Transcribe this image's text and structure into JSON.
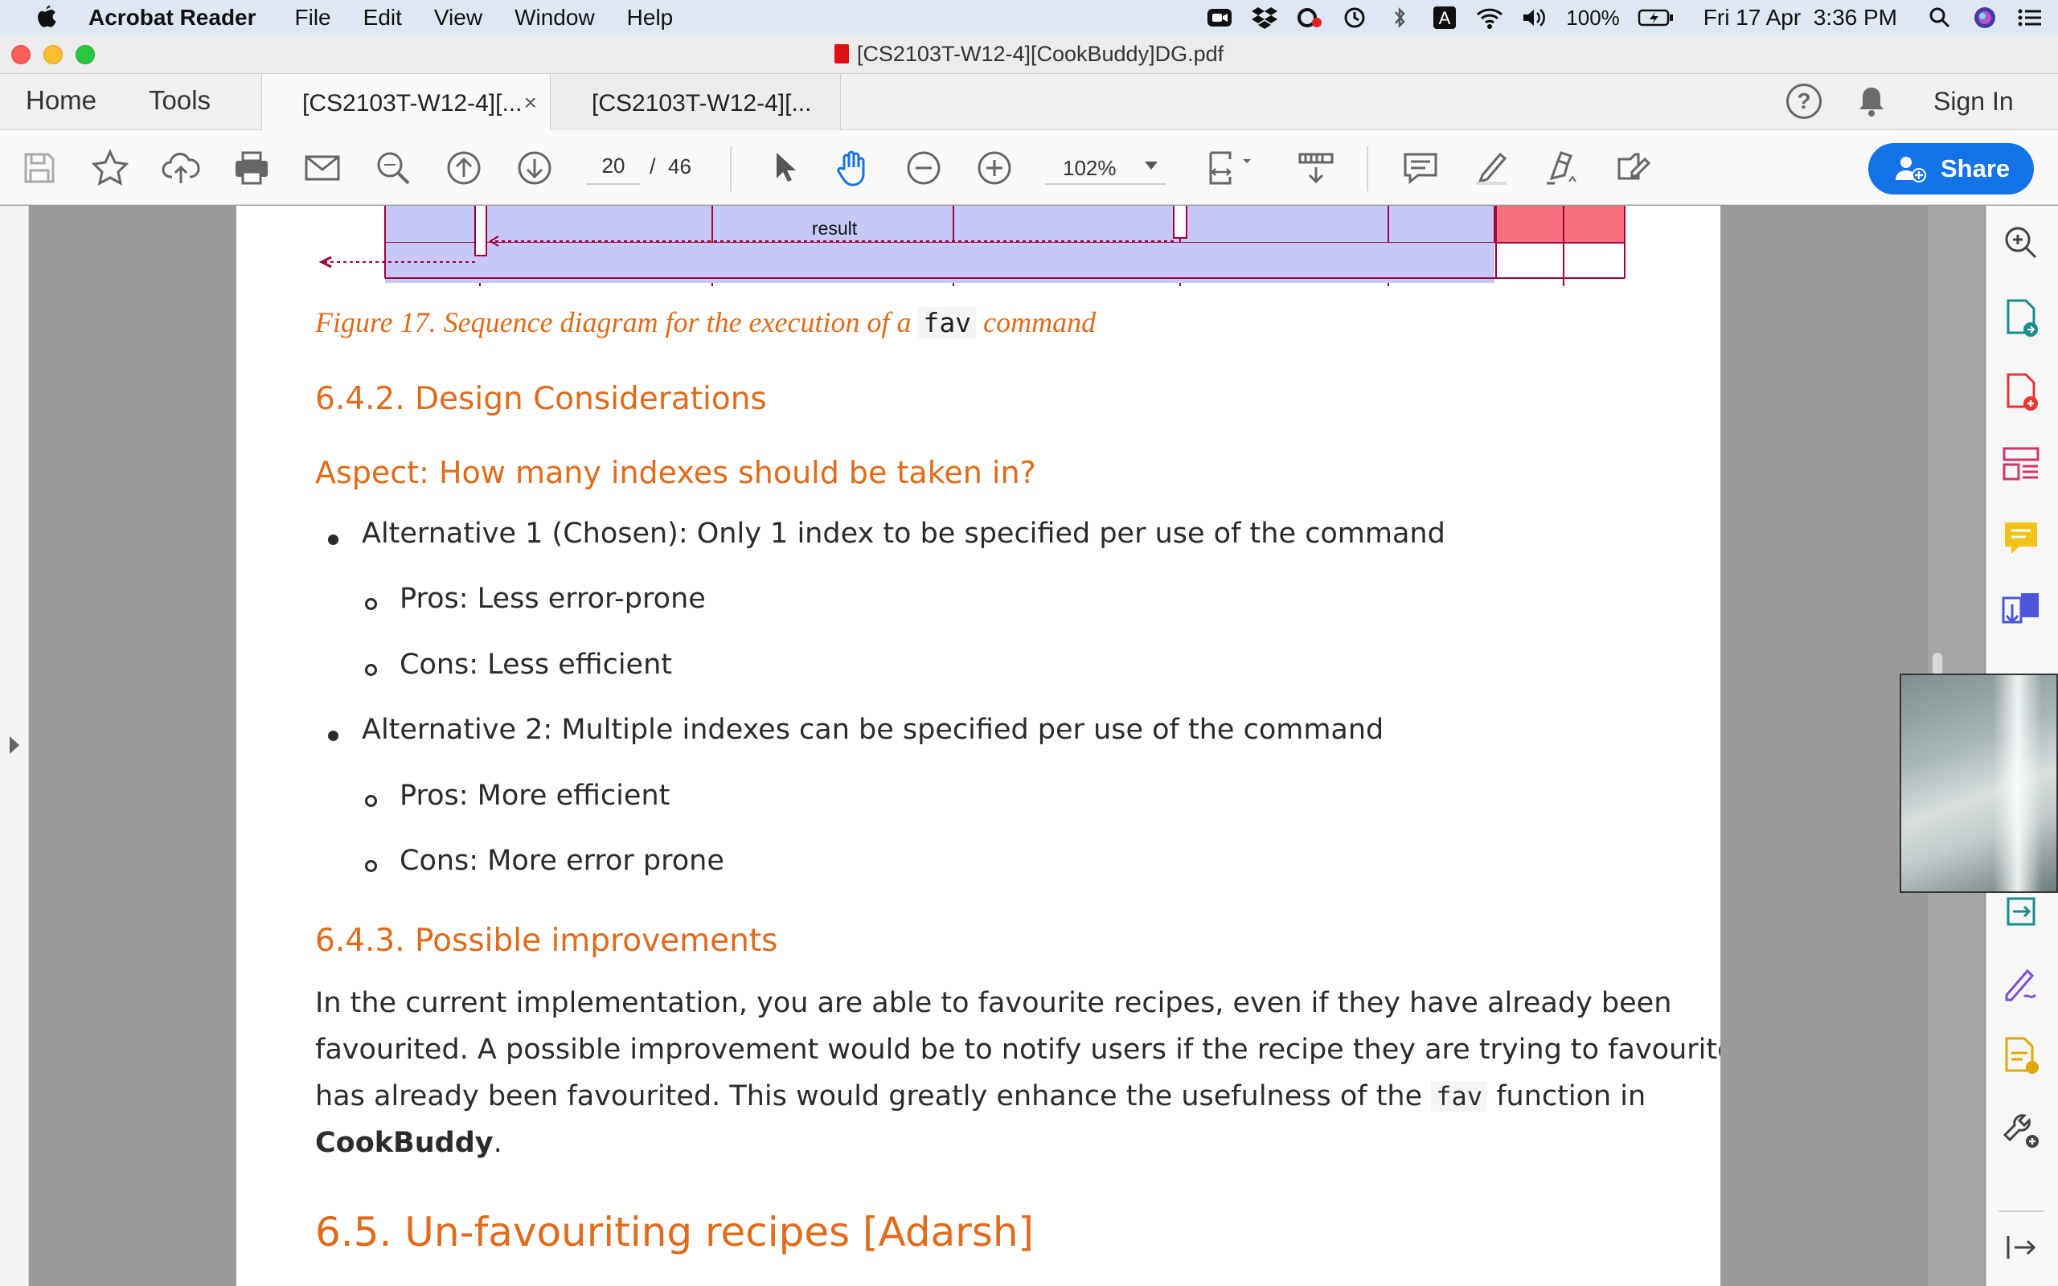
{
  "menubar": {
    "app_name": "Acrobat Reader",
    "menus": [
      "File",
      "Edit",
      "View",
      "Window",
      "Help"
    ],
    "battery": "100%",
    "clock": "Fri 17 Apr  3:36 PM",
    "input_source": "A"
  },
  "window": {
    "title": "[CS2103T-W12-4][CookBuddy]DG.pdf"
  },
  "tabs": {
    "home": "Home",
    "tools": "Tools",
    "docs": [
      "[CS2103T-W12-4][...",
      "[CS2103T-W12-4][..."
    ],
    "close": "×",
    "sign_in": "Sign In",
    "help": "?"
  },
  "toolbar": {
    "page_current": "20",
    "page_sep": "/",
    "page_total": "46",
    "zoom": "102%",
    "share": "Share"
  },
  "document": {
    "diagram_label": "result",
    "caption_before": "Figure 17. Sequence diagram for the execution of a ",
    "caption_code": "fav",
    "caption_after": " command",
    "h_design": "6.4.2. Design Considerations",
    "h_aspect": "Aspect: How many indexes should be taken in?",
    "alt1": "Alternative 1 (Chosen): Only 1 index to be specified per use of the command",
    "alt1_pros": "Pros: Less error-prone",
    "alt1_cons": "Cons: Less efficient",
    "alt2": "Alternative 2: Multiple indexes can be specified per use of the command",
    "alt2_pros": "Pros: More efficient",
    "alt2_cons": "Cons: More error prone",
    "h_improve": "6.4.3. Possible improvements",
    "para_line1": "In the current implementation, you are able to favourite recipes, even if they have already been",
    "para_line2": "favourited. A possible improvement would be to notify users if the recipe they are trying to favourite",
    "para_line3_a": "has already been favourited. This would greatly enhance the usefulness of the ",
    "para_line3_code": "fav",
    "para_line3_b": " function in",
    "para_bold": "CookBuddy",
    "para_end": ".",
    "h_unfav": "6.5. Un-favouriting recipes [Adarsh]"
  },
  "colors": {
    "heading": "#e16b1a",
    "accent": "#1473e6",
    "diagram_fill": "#c8c8f8",
    "diagram_stroke": "#a0003c",
    "diagram_red": "#f7707e"
  }
}
